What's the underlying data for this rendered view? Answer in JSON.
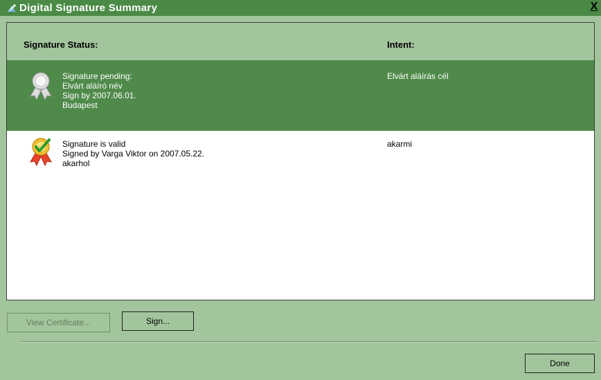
{
  "window": {
    "title": "Digital Signature Summary",
    "close_label": "X"
  },
  "list": {
    "headers": {
      "status": "Signature Status:",
      "intent": "Intent:"
    },
    "rows": [
      {
        "state": "pending",
        "selected": true,
        "icon": "ribbon-award-pending-icon",
        "lines": [
          "Signature pending:",
          "Elvárt aláíró név",
          "Sign by 2007.06.01.",
          "Budapest"
        ],
        "intent": "Elvárt aláírás cél"
      },
      {
        "state": "valid",
        "selected": false,
        "icon": "ribbon-award-valid-icon",
        "lines": [
          "Signature is valid",
          "Signed by Varga Viktor on 2007.05.22.",
          "akarhol"
        ],
        "intent": "akarmi"
      }
    ]
  },
  "buttons": {
    "view_certificate": {
      "label": "View Certificate...",
      "enabled": false
    },
    "sign": {
      "label": "Sign...",
      "enabled": true
    },
    "done": {
      "label": "Done",
      "enabled": true
    }
  },
  "colors": {
    "background": "#a3c59d",
    "titlebar": "#4a8a46",
    "selected_row": "#4f8a4a",
    "list_background": "#ffffff"
  }
}
